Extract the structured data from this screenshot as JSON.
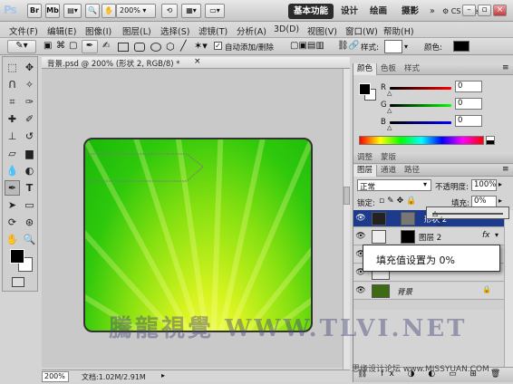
{
  "app": {
    "logo": "Ps"
  },
  "titlebar": {
    "br": "Br",
    "mb": "Mb",
    "zoom": "200%",
    "workspaces": [
      "基本功能",
      "设计",
      "绘画",
      "摄影"
    ],
    "more": "»",
    "cs_live": "CS Live"
  },
  "menu": [
    "文件(F)",
    "编辑(E)",
    "图像(I)",
    "图层(L)",
    "选择(S)",
    "滤镜(T)",
    "分析(A)",
    "3D(D)",
    "视图(V)",
    "窗口(W)",
    "帮助(H)"
  ],
  "options": {
    "auto_add_delete": "自动添加/删除",
    "style_label": "样式:",
    "color_label": "颜色:",
    "color_swatch": "#000000"
  },
  "document": {
    "tab_title": "背景.psd @ 200% (形状 2, RGB/8) *",
    "zoom": "200%",
    "info": "文档:1.02M/2.91M"
  },
  "color_panel": {
    "tabs": [
      "颜色",
      "色板",
      "样式"
    ],
    "channels": [
      {
        "label": "R",
        "value": "0"
      },
      {
        "label": "G",
        "value": "0"
      },
      {
        "label": "B",
        "value": "0"
      }
    ]
  },
  "adjust_panel": {
    "tabs": [
      "调整",
      "蒙版"
    ]
  },
  "layers_panel": {
    "tabs": [
      "图层",
      "通道",
      "路径"
    ],
    "blend_mode": "正常",
    "opacity_label": "不透明度:",
    "opacity_value": "100%",
    "lock_label": "锁定:",
    "fill_label": "填充:",
    "fill_value": "0%",
    "layers": [
      {
        "name": "形状 2",
        "selected": true
      },
      {
        "name": "图层 2",
        "selected": false,
        "fx": "fx"
      },
      {
        "name": "",
        "selected": false
      },
      {
        "name": "",
        "selected": false
      },
      {
        "name": "背景",
        "selected": false
      }
    ]
  },
  "tooltip": {
    "text": "填充值设置为 0%"
  },
  "watermark": {
    "text": "騰龍視覺 WWW.TLVI.NET",
    "corner": "思缘设计论坛  www.MISSYUAN.COM"
  }
}
